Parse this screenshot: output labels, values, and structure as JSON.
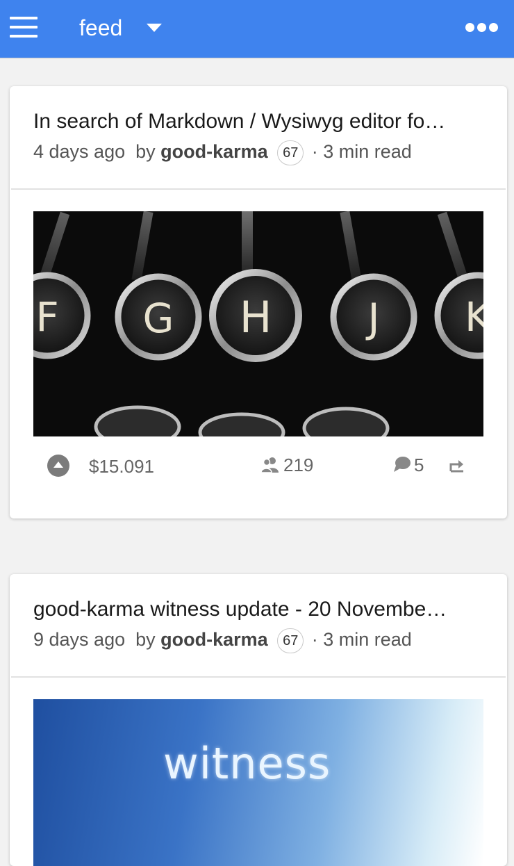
{
  "topbar": {
    "title": "feed",
    "menu_icon": "hamburger-menu-icon",
    "dropdown_icon": "caret-down-icon",
    "more_icon": "more-dots-icon",
    "background_color": "#3f83ee"
  },
  "posts": [
    {
      "title": "In search of Markdown / Wysiwyg editor fo…",
      "age": "4 days ago",
      "by_label": "by",
      "author": "good-karma",
      "reputation": "67",
      "read_time": "· 3 min read",
      "image_description_icon": "typewriter-keys-image",
      "key_letters": [
        "F",
        "G",
        "H",
        "J",
        "K"
      ],
      "payout": "$15.091",
      "voters": "219",
      "comments": "5"
    },
    {
      "title": "good-karma witness update - 20 Novembe…",
      "age": "9 days ago",
      "by_label": "by",
      "author": "good-karma",
      "reputation": "67",
      "read_time": "· 3 min read",
      "image_text": "witness"
    }
  ]
}
